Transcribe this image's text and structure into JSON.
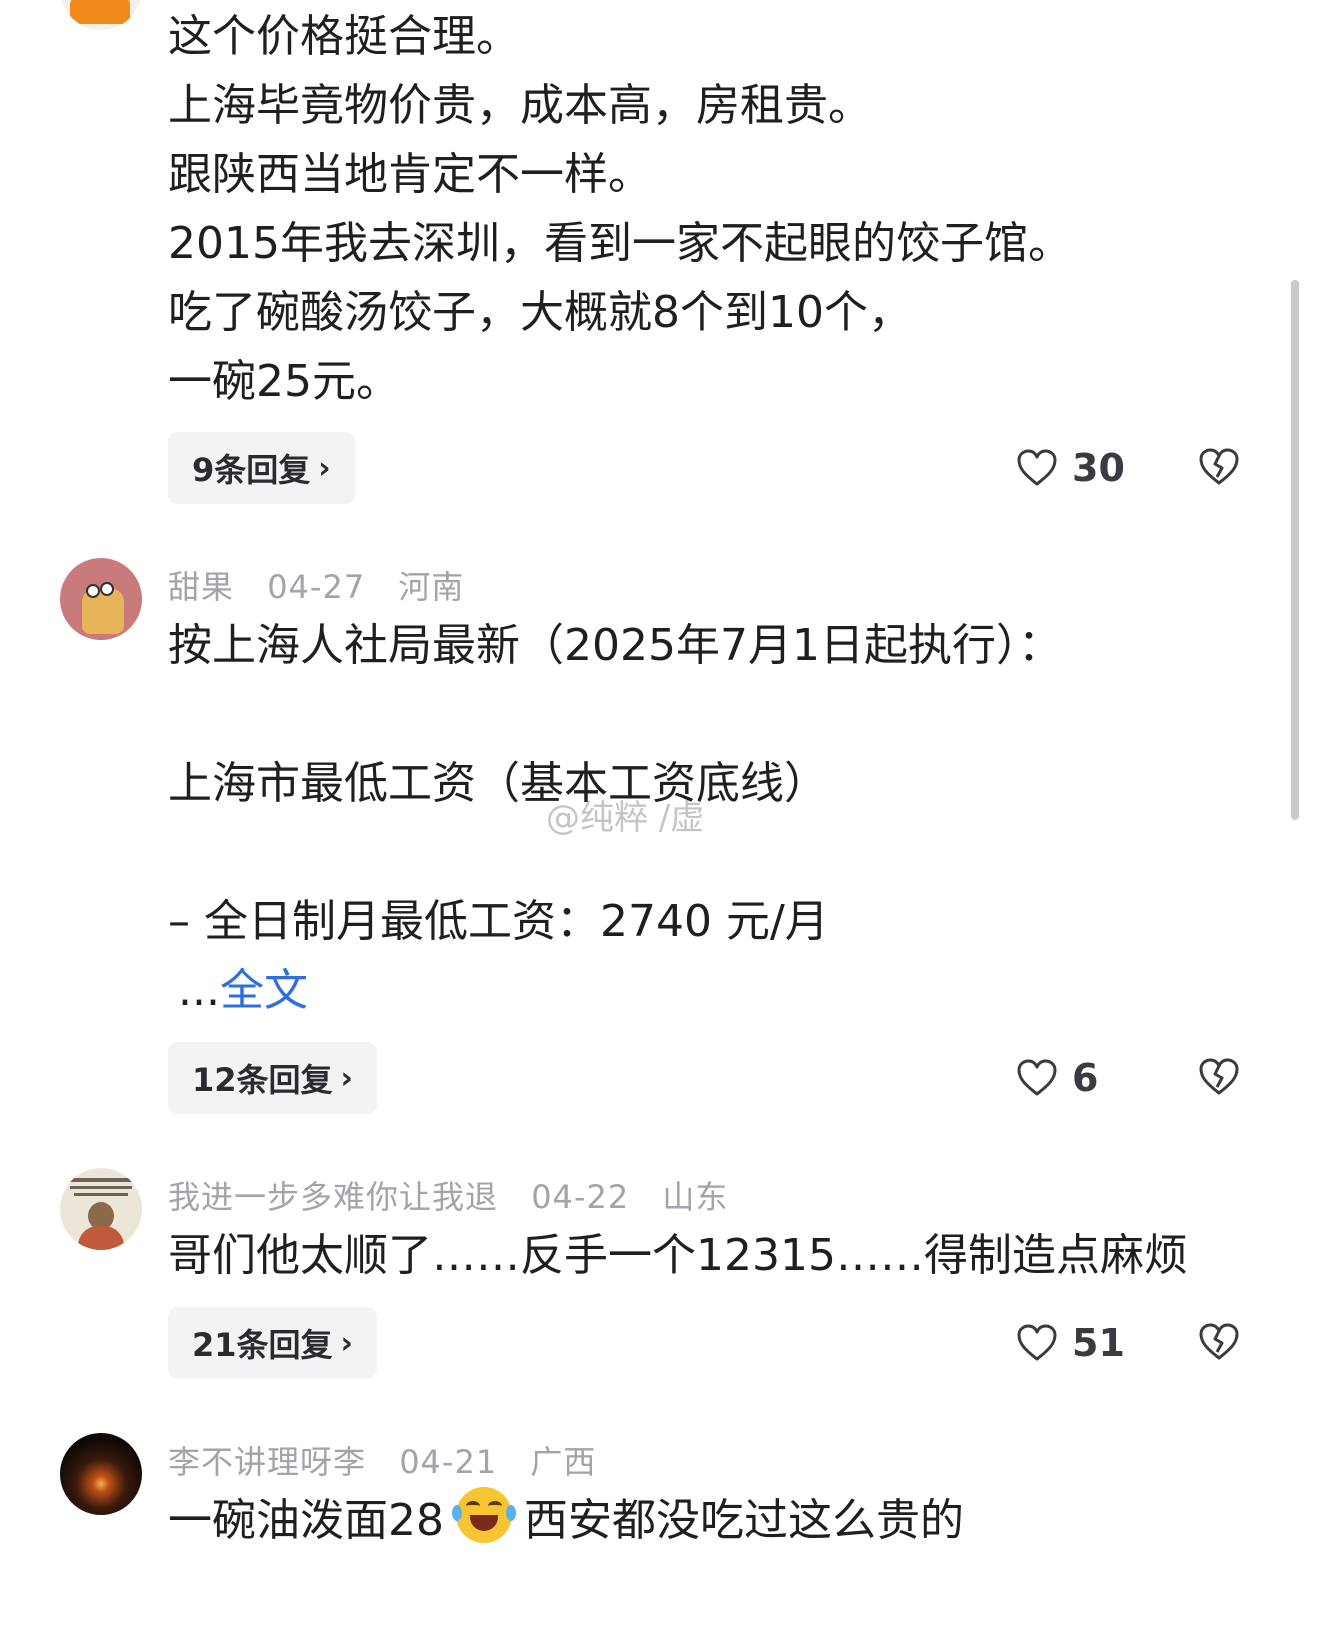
{
  "comments": [
    {
      "lines": [
        "这个价格挺合理。",
        "上海毕竟物价贵，成本高，房租贵。",
        "跟陕西当地肯定不一样。",
        "2015年我去深圳，看到一家不起眼的饺子馆。",
        "吃了碗酸汤饺子，大概就8个到10个，",
        "一碗25元。"
      ],
      "replies": "9条回复",
      "likes": "30"
    },
    {
      "user": "甜果",
      "date": "04-27",
      "location": "河南",
      "lines": [
        "按上海人社局最新（2025年7月1日起执行）：",
        "",
        "上海市最低工资（基本工资底线）",
        "",
        "– 全日制月最低工资：2740 元/月"
      ],
      "ellipsis": "...",
      "more": "全文",
      "replies": "12条回复",
      "likes": "6"
    },
    {
      "user": "我进一步多难你让我退",
      "date": "04-22",
      "location": "山东",
      "lines": [
        "哥们他太顺了……反手一个12315……得制造点麻烦"
      ],
      "replies": "21条回复",
      "likes": "51"
    },
    {
      "user": "李不讲理呀李",
      "date": "04-21",
      "location": "广西",
      "text_before": "一碗油泼面28",
      "emoji": "laughing-crying-emoji",
      "text_after": "西安都没吃过这么贵的"
    }
  ],
  "watermark": "@纯粹 /虚"
}
